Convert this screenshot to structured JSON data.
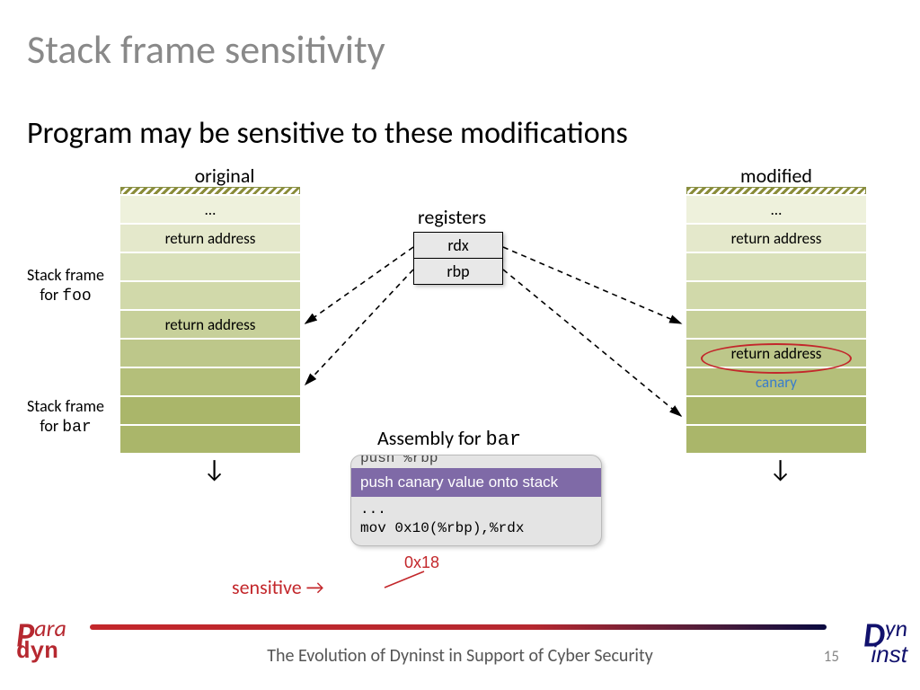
{
  "title": "Stack frame sensitivity",
  "subtitle": "Program may be sensitive to these modifications",
  "columns": {
    "left": "original",
    "right": "modified"
  },
  "frame_labels": {
    "foo_line1": "Stack frame",
    "foo_line2": "for ",
    "foo_func": "foo",
    "bar_line1": "Stack frame",
    "bar_line2": "for ",
    "bar_func": "bar"
  },
  "stacks": {
    "original": [
      "…",
      "return address",
      "",
      "",
      "return address",
      "",
      "",
      "",
      ""
    ],
    "modified": [
      "…",
      "return address",
      "",
      "",
      "",
      "return address",
      "canary",
      "",
      ""
    ]
  },
  "registers": {
    "label": "registers",
    "items": [
      "rdx",
      "rbp"
    ]
  },
  "assembly": {
    "label_prefix": "Assembly for ",
    "func": "bar",
    "peek": "push %rbp",
    "highlight": "push canary value onto stack",
    "body_line1": "...",
    "body_line2": "mov 0x10(%rbp),%rdx"
  },
  "annotations": {
    "sensitive": "sensitive →",
    "offset": "0x18"
  },
  "footer": {
    "text": "The Evolution of Dyninst in Support of Cyber Security",
    "page": "15"
  },
  "logos": {
    "paradyn_P": "P",
    "paradyn_ara": "ara",
    "paradyn_dyn": "dyn",
    "dyninst_D": "D",
    "dyninst_yn": "yn",
    "dyninst_inst": "inst"
  }
}
